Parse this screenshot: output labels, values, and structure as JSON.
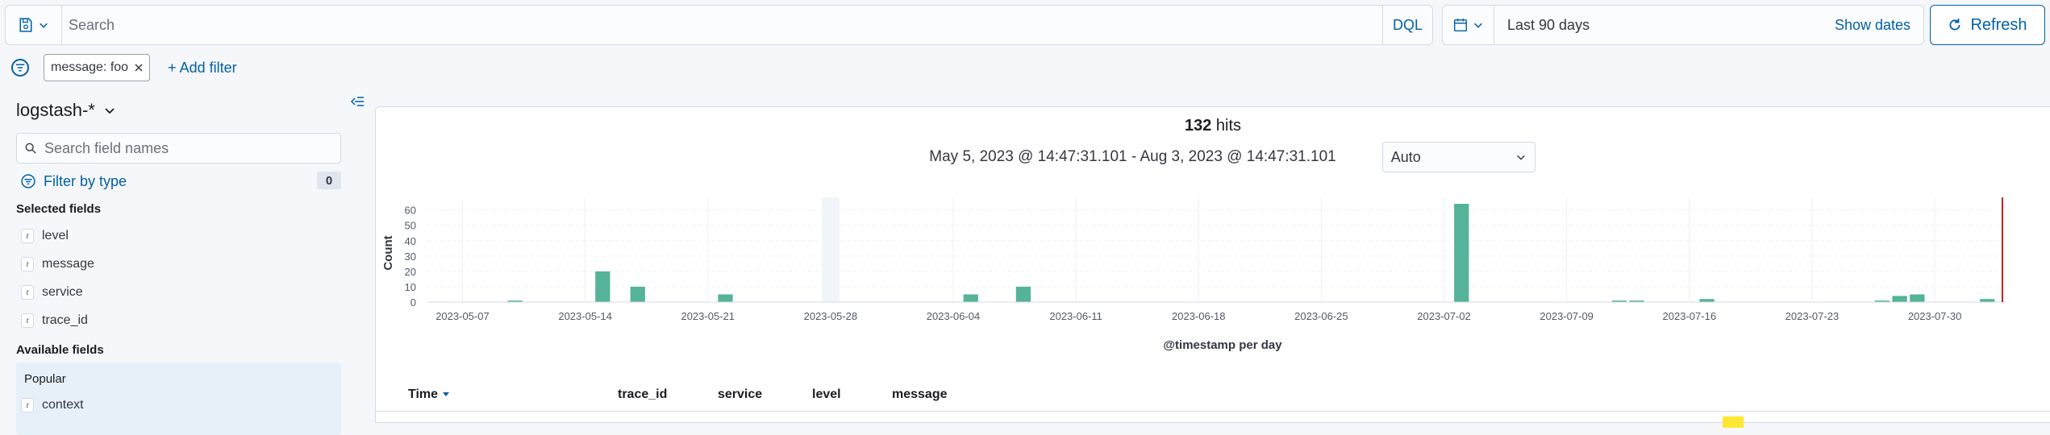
{
  "query": {
    "search_placeholder": "Search",
    "language": "DQL"
  },
  "date": {
    "range_label": "Last 90 days",
    "show_dates": "Show dates"
  },
  "refresh_label": "Refresh",
  "filters": {
    "pills": [
      "message: foo"
    ],
    "add_filter": "+ Add filter"
  },
  "sidebar": {
    "index_pattern": "logstash-*",
    "search_placeholder": "Search field names",
    "filter_by_type": "Filter by type",
    "filter_count": "0",
    "selected_title": "Selected fields",
    "selected_fields": [
      {
        "type": "t",
        "name": "level"
      },
      {
        "type": "t",
        "name": "message"
      },
      {
        "type": "t",
        "name": "service"
      },
      {
        "type": "t",
        "name": "trace_id"
      }
    ],
    "available_title": "Available fields",
    "popular_title": "Popular",
    "popular_fields": [
      {
        "type": "t",
        "name": "context"
      }
    ]
  },
  "results": {
    "hits_count": "132",
    "hits_label": "hits",
    "range_text": "May 5, 2023 @ 14:47:31.101 - Aug 3, 2023 @ 14:47:31.101",
    "interval": "Auto"
  },
  "chart_data": {
    "type": "bar",
    "xlabel": "@timestamp per day",
    "ylabel": "Count",
    "ylim": [
      0,
      64
    ],
    "yticks": [
      0,
      10,
      20,
      30,
      40,
      50,
      60
    ],
    "x_start": "2023-05-05",
    "x_end": "2023-08-03",
    "x_tick_labels": [
      "2023-05-07",
      "2023-05-14",
      "2023-05-21",
      "2023-05-28",
      "2023-06-04",
      "2023-06-11",
      "2023-06-18",
      "2023-06-25",
      "2023-07-02",
      "2023-07-09",
      "2023-07-16",
      "2023-07-23",
      "2023-07-30"
    ],
    "bars": [
      {
        "date": "2023-05-10",
        "value": 1
      },
      {
        "date": "2023-05-15",
        "value": 20
      },
      {
        "date": "2023-05-17",
        "value": 10
      },
      {
        "date": "2023-05-22",
        "value": 5
      },
      {
        "date": "2023-06-05",
        "value": 5
      },
      {
        "date": "2023-06-08",
        "value": 10
      },
      {
        "date": "2023-07-03",
        "value": 65
      },
      {
        "date": "2023-07-12",
        "value": 1
      },
      {
        "date": "2023-07-13",
        "value": 1
      },
      {
        "date": "2023-07-17",
        "value": 2
      },
      {
        "date": "2023-07-27",
        "value": 1
      },
      {
        "date": "2023-07-28",
        "value": 4
      },
      {
        "date": "2023-07-29",
        "value": 5
      },
      {
        "date": "2023-08-02",
        "value": 2
      }
    ],
    "highlight_band_date": "2023-05-28",
    "now_marker_date": "2023-08-03",
    "bar_color": "#54b399",
    "now_color": "#bd271e",
    "grid": true
  },
  "table": {
    "columns": [
      "Time",
      "trace_id",
      "service",
      "level",
      "message"
    ]
  }
}
